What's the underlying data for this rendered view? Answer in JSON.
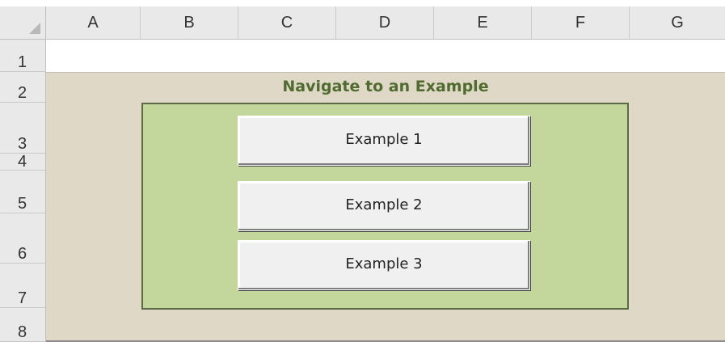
{
  "columns": [
    "A",
    "B",
    "C",
    "D",
    "E",
    "F",
    "G"
  ],
  "rows": [
    "1",
    "2",
    "3",
    "4",
    "5",
    "6",
    "7",
    "8"
  ],
  "sheet": {
    "title": "Navigate to an Example",
    "buttons": [
      "Example 1",
      "Example 2",
      "Example 3"
    ]
  },
  "colors": {
    "panel_bg": "#dfd8c6",
    "inner_bg": "#c3d69b",
    "title_color": "#4f6b2f"
  }
}
